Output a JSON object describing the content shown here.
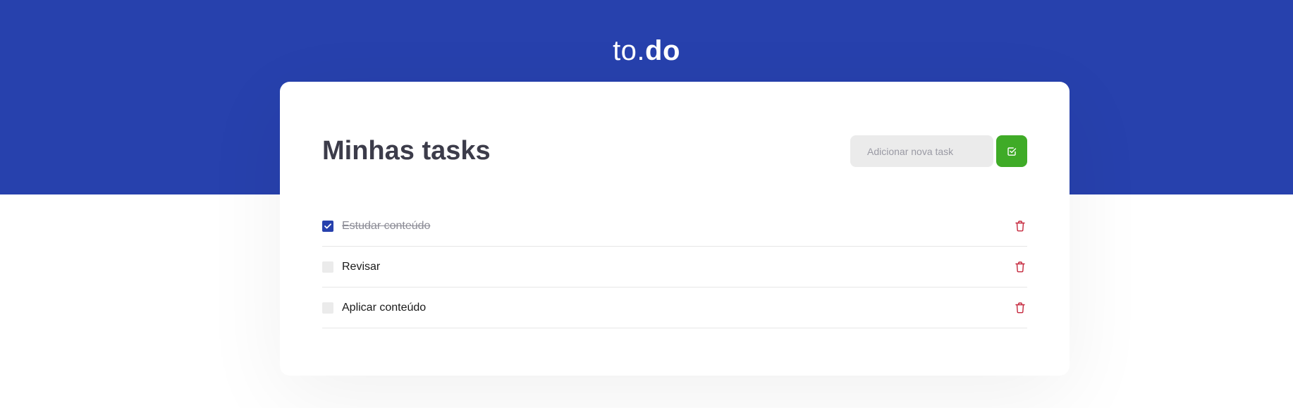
{
  "header": {
    "logo_light": "to.",
    "logo_bold": "do"
  },
  "colors": {
    "header_bg": "#2741ad",
    "add_button": "#3fab27",
    "checkbox_checked": "#2741ad",
    "trash_icon": "#c5283d",
    "title": "#3c3c4a"
  },
  "card": {
    "title": "Minhas tasks",
    "new_task_input": {
      "placeholder": "Adicionar nova task",
      "value": ""
    },
    "add_button_icon": "check-square-icon"
  },
  "tasks": [
    {
      "title": "Estudar conteúdo",
      "is_complete": true
    },
    {
      "title": "Revisar",
      "is_complete": false
    },
    {
      "title": "Aplicar conteúdo",
      "is_complete": false
    }
  ]
}
